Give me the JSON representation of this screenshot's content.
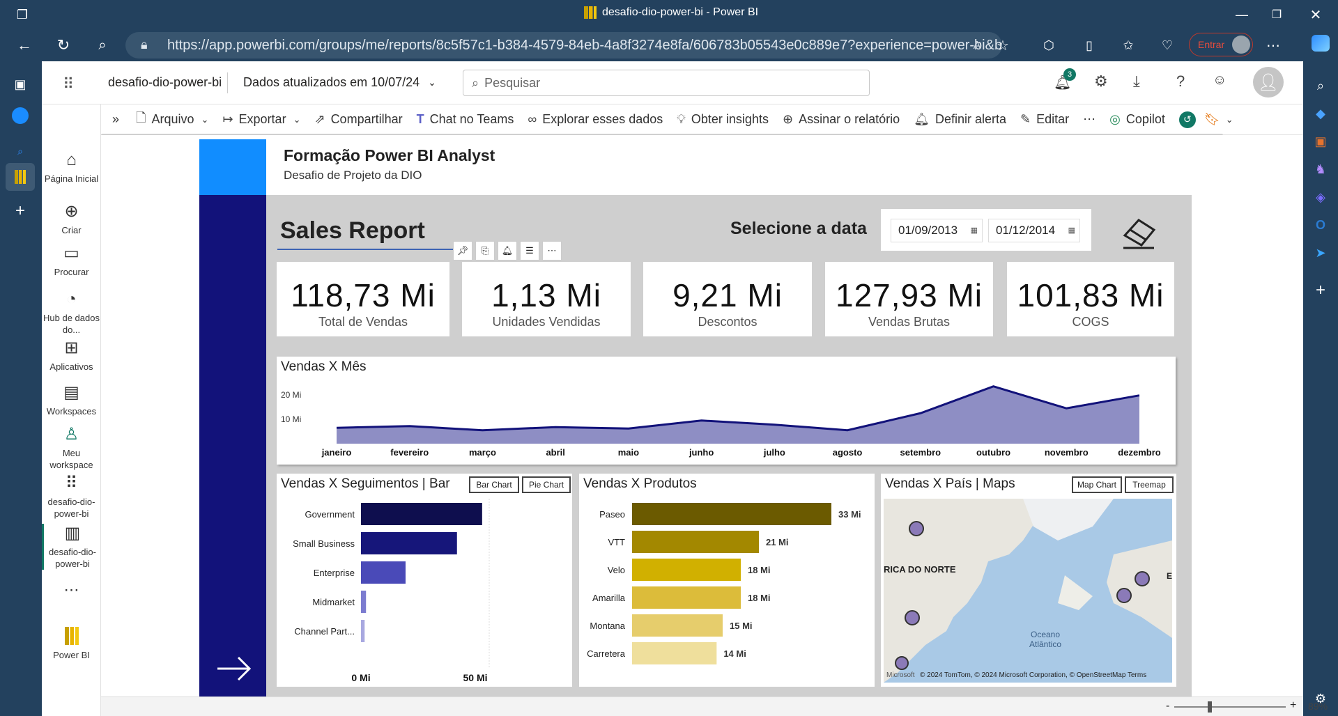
{
  "window": {
    "title": "desafio-dio-power-bi - Power BI"
  },
  "browser": {
    "url": "https://app.powerbi.com/groups/me/reports/8c5f57c1-b384-4579-84eb-4a8f3274e8fa/606783b05543e0c889e7?experience=power-bi&bookm...",
    "profile_label": "Entrar"
  },
  "pbi": {
    "workspace": "desafio-dio-power-bi",
    "updated": "Dados atualizados em 10/07/24",
    "search_placeholder": "Pesquisar",
    "notif_count": "3"
  },
  "nav": [
    {
      "label": "Página Inicial",
      "icon": "home-icon"
    },
    {
      "label": "Criar",
      "icon": "plus-circle-icon"
    },
    {
      "label": "Procurar",
      "icon": "folder-icon"
    },
    {
      "label": "Hub de dados do...",
      "icon": "data-hub-icon"
    },
    {
      "label": "Aplicativos",
      "icon": "apps-icon"
    },
    {
      "label": "Workspaces",
      "icon": "workspaces-icon"
    },
    {
      "label": "Meu workspace",
      "icon": "person-icon"
    },
    {
      "label": "desafio-dio-power-bi",
      "icon": "dashboard-icon"
    },
    {
      "label": "desafio-dio-power-bi",
      "icon": "report-icon"
    },
    {
      "label": "Power BI",
      "icon": "powerbi-logo-icon"
    }
  ],
  "toolbar": [
    "Arquivo",
    "Exportar",
    "Compartilhar",
    "Chat no Teams",
    "Explorar esses dados",
    "Obter insights",
    "Assinar o relatório",
    "Definir alerta",
    "Editar",
    "Copilot"
  ],
  "report": {
    "title": "Formação Power BI Analyst",
    "subtitle": "Desafio de Projeto da DIO",
    "heading": "Sales Report",
    "date_label": "Selecione a data",
    "date_from": "01/09/2013",
    "date_to": "01/12/2014",
    "cards": [
      {
        "value": "118,73 Mi",
        "label": "Total de Vendas"
      },
      {
        "value": "1,13 Mi",
        "label": "Unidades Vendidas"
      },
      {
        "value": "9,21 Mi",
        "label": "Descontos"
      },
      {
        "value": "127,93 Mi",
        "label": "Vendas Brutas"
      },
      {
        "value": "101,83 Mi",
        "label": "COGS"
      }
    ]
  },
  "chart_data": [
    {
      "type": "area",
      "title": "Vendas X Mês",
      "categories": [
        "janeiro",
        "fevereiro",
        "março",
        "abril",
        "maio",
        "junho",
        "julho",
        "agosto",
        "setembro",
        "outubro",
        "novembro",
        "dezembro"
      ],
      "values": [
        6.5,
        7.2,
        5.5,
        6.8,
        6.2,
        9.5,
        7.8,
        5.5,
        12.5,
        23.5,
        14.5,
        19.8
      ],
      "y_ticks": [
        "20 Mi",
        "10 Mi"
      ],
      "ylim": [
        0,
        30
      ]
    },
    {
      "type": "bar",
      "title": "Vendas X Seguimentos | Bar",
      "buttons": [
        "Bar Chart",
        "Pie Chart"
      ],
      "categories": [
        "Government",
        "Small Business",
        "Enterprise",
        "Midmarket",
        "Channel Part..."
      ],
      "values": [
        53,
        42,
        19.5,
        2.2,
        1.6
      ],
      "x_ticks": [
        "0 Mi",
        "50 Mi"
      ],
      "xlim": [
        0,
        55
      ]
    },
    {
      "type": "bar",
      "title": "Vendas X Produtos",
      "categories": [
        "Paseo",
        "VTT",
        "Velo",
        "Amarilla",
        "Montana",
        "Carretera"
      ],
      "values": [
        33,
        21,
        18,
        18,
        15,
        14
      ],
      "labels": [
        "33 Mi",
        "21 Mi",
        "18 Mi",
        "18 Mi",
        "15 Mi",
        "14 Mi"
      ]
    }
  ],
  "map": {
    "title": "Vendas X País | Maps",
    "buttons": [
      "Map Chart",
      "Treemap"
    ],
    "label_na": "RICA DO NORTE",
    "label_ocean": "Oceano Atlântico",
    "label_eu": "E",
    "attribution": "© 2024 TomTom, © 2024 Microsoft Corporation, © OpenStreetMap  Terms",
    "brand": "Microsoft"
  },
  "status": {
    "zoom": "89%"
  },
  "colors": {
    "navy": "#12127a",
    "area": "#8e8ec4",
    "bar1": "#0e0e4e",
    "gold": "#6b5a00",
    "accent": "#118dff"
  }
}
